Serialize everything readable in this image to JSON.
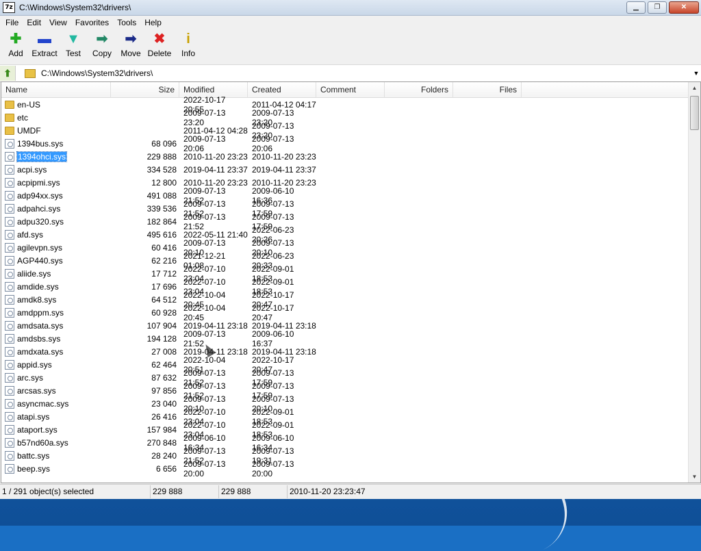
{
  "window": {
    "title": "C:\\Windows\\System32\\drivers\\",
    "app_icon": "7z"
  },
  "menu": [
    "File",
    "Edit",
    "View",
    "Favorites",
    "Tools",
    "Help"
  ],
  "toolbar": [
    {
      "label": "Add",
      "icon": "add-icon",
      "glyph": "✚",
      "color": "#22aa22"
    },
    {
      "label": "Extract",
      "icon": "extract-icon",
      "glyph": "▬",
      "color": "#2244cc"
    },
    {
      "label": "Test",
      "icon": "test-icon",
      "glyph": "▼",
      "color": "#22b8a0"
    },
    {
      "label": "Copy",
      "icon": "copy-icon",
      "glyph": "➡",
      "color": "#228866"
    },
    {
      "label": "Move",
      "icon": "move-icon",
      "glyph": "➡",
      "color": "#1a2a88"
    },
    {
      "label": "Delete",
      "icon": "delete-icon",
      "glyph": "✖",
      "color": "#dd2222"
    },
    {
      "label": "Info",
      "icon": "info-icon",
      "glyph": "i",
      "color": "#c8a000"
    }
  ],
  "address": {
    "path": "C:\\Windows\\System32\\drivers\\"
  },
  "columns": [
    "Name",
    "Size",
    "Modified",
    "Created",
    "Comment",
    "Folders",
    "Files"
  ],
  "files": [
    {
      "name": "en-US",
      "size": "",
      "modified": "2022-10-17 20:55",
      "created": "2011-04-12 04:17",
      "type": "folder"
    },
    {
      "name": "etc",
      "size": "",
      "modified": "2009-07-13 23:20",
      "created": "2009-07-13 23:20",
      "type": "folder"
    },
    {
      "name": "UMDF",
      "size": "",
      "modified": "2011-04-12 04:28",
      "created": "2009-07-13 23:20",
      "type": "folder"
    },
    {
      "name": "1394bus.sys",
      "size": "68 096",
      "modified": "2009-07-13 20:06",
      "created": "2009-07-13 20:06",
      "type": "file"
    },
    {
      "name": "1394ohci.sys",
      "size": "229 888",
      "modified": "2010-11-20 23:23",
      "created": "2010-11-20 23:23",
      "type": "file",
      "selected": true
    },
    {
      "name": "acpi.sys",
      "size": "334 528",
      "modified": "2019-04-11 23:37",
      "created": "2019-04-11 23:37",
      "type": "file"
    },
    {
      "name": "acpipmi.sys",
      "size": "12 800",
      "modified": "2010-11-20 23:23",
      "created": "2010-11-20 23:23",
      "type": "file"
    },
    {
      "name": "adp94xx.sys",
      "size": "491 088",
      "modified": "2009-07-13 21:52",
      "created": "2009-06-10 16:36",
      "type": "file"
    },
    {
      "name": "adpahci.sys",
      "size": "339 536",
      "modified": "2009-07-13 21:52",
      "created": "2009-07-13 17:59",
      "type": "file"
    },
    {
      "name": "adpu320.sys",
      "size": "182 864",
      "modified": "2009-07-13 21:52",
      "created": "2009-07-13 17:59",
      "type": "file"
    },
    {
      "name": "afd.sys",
      "size": "495 616",
      "modified": "2022-05-11 21:40",
      "created": "2022-06-23 20:26",
      "type": "file"
    },
    {
      "name": "agilevpn.sys",
      "size": "60 416",
      "modified": "2009-07-13 20:10",
      "created": "2009-07-13 20:10",
      "type": "file"
    },
    {
      "name": "AGP440.sys",
      "size": "62 216",
      "modified": "2021-12-21 01:08",
      "created": "2022-06-23 20:33",
      "type": "file"
    },
    {
      "name": "aliide.sys",
      "size": "17 712",
      "modified": "2022-07-10 23:04",
      "created": "2022-09-01 18:53",
      "type": "file"
    },
    {
      "name": "amdide.sys",
      "size": "17 696",
      "modified": "2022-07-10 23:04",
      "created": "2022-09-01 18:53",
      "type": "file"
    },
    {
      "name": "amdk8.sys",
      "size": "64 512",
      "modified": "2022-10-04 20:45",
      "created": "2022-10-17 20:47",
      "type": "file"
    },
    {
      "name": "amdppm.sys",
      "size": "60 928",
      "modified": "2022-10-04 20:45",
      "created": "2022-10-17 20:47",
      "type": "file"
    },
    {
      "name": "amdsata.sys",
      "size": "107 904",
      "modified": "2019-04-11 23:18",
      "created": "2019-04-11 23:18",
      "type": "file"
    },
    {
      "name": "amdsbs.sys",
      "size": "194 128",
      "modified": "2009-07-13 21:52",
      "created": "2009-06-10 16:37",
      "type": "file"
    },
    {
      "name": "amdxata.sys",
      "size": "27 008",
      "modified": "2019-04-11 23:18",
      "created": "2019-04-11 23:18",
      "type": "file"
    },
    {
      "name": "appid.sys",
      "size": "62 464",
      "modified": "2022-10-04 20:51",
      "created": "2022-10-17 20:47",
      "type": "file"
    },
    {
      "name": "arc.sys",
      "size": "87 632",
      "modified": "2009-07-13 21:52",
      "created": "2009-07-13 17:59",
      "type": "file"
    },
    {
      "name": "arcsas.sys",
      "size": "97 856",
      "modified": "2009-07-13 21:52",
      "created": "2009-07-13 17:59",
      "type": "file"
    },
    {
      "name": "asyncmac.sys",
      "size": "23 040",
      "modified": "2009-07-13 20:10",
      "created": "2009-07-13 20:10",
      "type": "file"
    },
    {
      "name": "atapi.sys",
      "size": "26 416",
      "modified": "2022-07-10 23:04",
      "created": "2022-09-01 18:53",
      "type": "file"
    },
    {
      "name": "ataport.sys",
      "size": "157 984",
      "modified": "2022-07-10 23:04",
      "created": "2022-09-01 18:53",
      "type": "file"
    },
    {
      "name": "b57nd60a.sys",
      "size": "270 848",
      "modified": "2009-06-10 16:34",
      "created": "2009-06-10 16:34",
      "type": "file"
    },
    {
      "name": "battc.sys",
      "size": "28 240",
      "modified": "2009-07-13 21:52",
      "created": "2009-07-13 19:31",
      "type": "file"
    },
    {
      "name": "beep.sys",
      "size": "6 656",
      "modified": "2009-07-13 20:00",
      "created": "2009-07-13 20:00",
      "type": "file"
    }
  ],
  "status": {
    "selection": "1 / 291 object(s) selected",
    "size": "229 888",
    "packed": "229 888",
    "date": "2010-11-20 23:23:47"
  }
}
